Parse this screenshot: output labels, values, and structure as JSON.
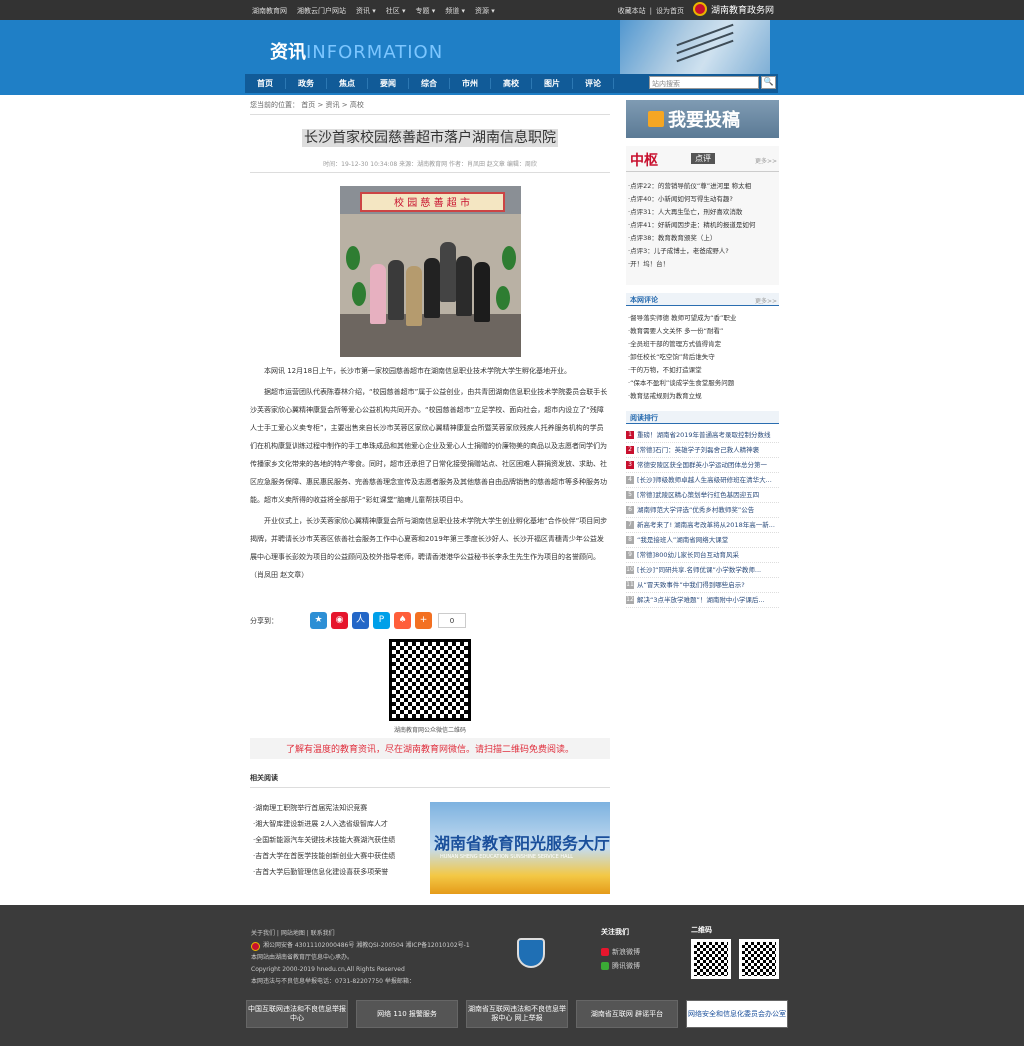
{
  "topbar": {
    "left": [
      "湖南教育网",
      "湘教云门户网站",
      "资讯 ▾",
      "社区 ▾",
      "专题 ▾",
      "频道 ▾",
      "资源 ▾"
    ],
    "right": [
      "收藏本站",
      "|",
      "设为首页"
    ],
    "gov": "湖南教育政务网"
  },
  "header": {
    "brand_cn": "资讯",
    "brand_en": "INFORMATION"
  },
  "nav": [
    "首页",
    "政务",
    "焦点",
    "要闻",
    "综合",
    "市州",
    "高校",
    "图片",
    "评论"
  ],
  "search": {
    "placeholder": "站内搜索",
    "button": "🔍"
  },
  "article": {
    "crumbs": "您当前的位置： 首页 > 资讯 > 高校",
    "title": "长沙首家校园慈善超市落户湖南信息职院",
    "meta": "时间：19-12-30 10:34:08 来源：湖南教育网 作者：肖凤田 赵文章 编辑：周欣",
    "photo_sign": "校 园 慈 善 超 市",
    "paragraphs": [
      "本网讯 12月18日上午，长沙市第一家校园慈善超市在湖南信息职业技术学院大学生孵化基地开业。",
      "据超市运营团队代表陈春林介绍，“校园慈善超市”属于公益创业，由共青团湖南信息职业技术学院委员会联手长沙芙蓉家欣心翼精神康复会所等爱心公益机构共同开办。“校园慈善超市”立足学校、面向社会，超市内设立了“残障人士手工爱心义卖专柜”，主要出售来自长沙市芙蓉区家欣心翼精神康复会所暨芙蓉家欣残疾人托养服务机构的学员们在机构康复训练过程中制作的手工串珠成品和其他爱心企业及爱心人士捐赠的价廉物美的商品以及志愿者同学们为传播家乡文化带来的各地的特产零食。同时，超市还承担了日常化接受捐赠站点、社区困难人群捐资发放、求助、社区应急服务保障、惠民惠民服务、完善慈善理念宣传及志愿者服务及其他慈善自由品牌销售的慈善超市等多种服务功能。超市义卖所得的收益将全部用于“彩虹课堂”脑瘫儿童帮扶项目中。",
      "开业仪式上，长沙芙蓉家欣心翼精神康复会所与湖南信息职业技术学院大学生创业孵化基地“合作伙伴”项目同步揭牌，并聘请长沙市芙蓉区依善社会服务工作中心夏蓉和2019年第三季度长沙好人、长沙开福区青穗青少年公益发展中心理事长彭姣为项目的公益顾问及校外指导老师，聘请香港港华公益秘书长李永生先生作为项目的名誉顾问。（肖凤田 赵文章）"
    ],
    "share_label": "分享到：",
    "share_count": "0",
    "qr_caption": "湖南教育网公众微信二维码",
    "promo": "了解有温度的教育资讯，尽在湖南教育网微信。请扫描二维码免费阅读。",
    "related_title": "相关阅读",
    "related": [
      "·湖南理工职院举行首届宪法知识竞赛",
      "·湘大智库建设新进展 2人入选省级智库人才",
      "·全国新能源汽车关键技术技能大赛湖汽获佳绩",
      "·吉首大学在首医学技能创新创业大赛中获佳绩",
      "·吉首大学后勤管理信息化建设喜获多项荣誉"
    ],
    "banner_title": "湖南省教育阳光服务大厅",
    "banner_sub": "HUNAN SHENG EDUCATION SUNSHINE SERVICE HALL"
  },
  "sidebar": {
    "tougao": "我要投稿",
    "zhongping_logo": "中枢",
    "zhongping_tag": "点评",
    "more": "更多>>",
    "zhongping_items": [
      "·点评22：的营销导航仪“尊”进河里 称太相",
      "·点评40：小新闻如何写得生动有趣?",
      "·点评31：人大再生坠亡，刑好喜欢消散",
      "·点评41：好新闻因步走：精机的报道是如何",
      "·点评38：教育教育颁奖（上）",
      "·点评3：儿子成博士，老爸成野人?",
      "·开！坞！台！"
    ],
    "comment_head": "本网评论",
    "comments": [
      "·督导落实师德 教师可望成为“香”职业",
      "·教育需要人文关怀 多一份“耐看”",
      "·全员班干部的管理方式值得肯定",
      "·卸任校长“吃空饷”背后谁失守",
      "·干的万物，不如打造课堂",
      "·“保本不盈利”谈成学生食堂服务问题",
      "·教育惩戒规则为教育立规"
    ],
    "rank_head": "阅读排行",
    "rank": [
      "重磅！湖南省2019年普通高考录取控制分数线",
      "[常德]石门：英雄学子刘磊舍己救人精神褒",
      "常德安陵区获全国群英小学运动团体总分第一",
      "[长沙]师级教师卓越人生高级研修班在清华大...",
      "[常德]武陵区精心策划举行红色基因迎五四",
      "湖南师范大学评选“优秀乡村教师奖”公告",
      "新高考来了! 湖南高考改革将从2018年高一新...",
      "“我是接班人”湖南省网络大课堂",
      "[常德]800幼儿家长同台互动育风采",
      "[长沙]“同研共享.名师优课”小学数学教师...",
      "从“冒天致事件”中我们得到哪些启示?",
      "解决“3点半放学难题”！湖南附中小学课后..."
    ]
  },
  "footer": {
    "links": "关于我们 | 网站地图 | 联系我们",
    "line1": "湘公网安备 43011102000486号 湘教QSI-200504 湘ICP备12010102号-1",
    "line2": "本网站由湖南省教育厅信息中心承办。",
    "line3": "Copyright 2000-2019 hnedu.cn,All Rights Reserved",
    "line4": "本网违法与不良信息举报电话：0731-82207750 举报邮箱：",
    "follow_title": "关注我们",
    "weibo": "新浪微博",
    "tweibo": "腾讯微博",
    "qr_title": "二维码",
    "badges": [
      "中国互联网违法和不良信息举报中心",
      "网络 110 报警服务",
      "湖南省互联网违法和不良信息举报中心 网上举报",
      "湖南省互联网 辟谣平台",
      "网络安全和信息化委员会办公室"
    ]
  },
  "colors": {
    "nav": "#115b98",
    "header": "#1f7fc6",
    "accent": "#c8102e"
  }
}
